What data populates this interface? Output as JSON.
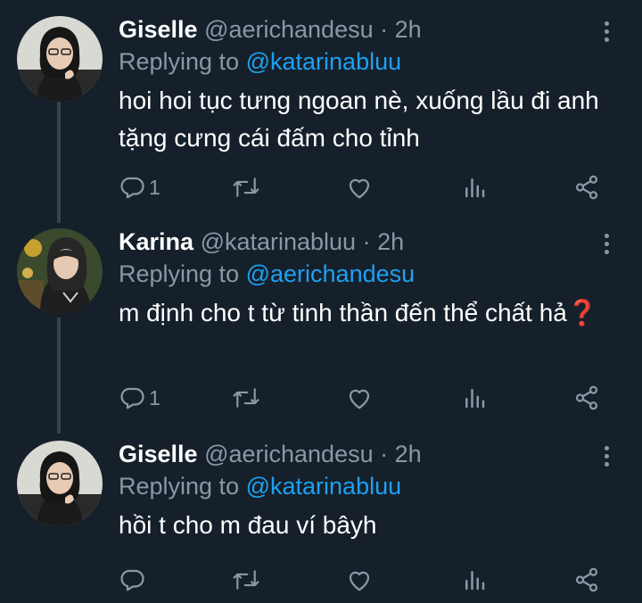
{
  "tweets": [
    {
      "name": "Giselle",
      "handle": "@aerichandesu",
      "separator": "·",
      "time": "2h",
      "replying_prefix": "Replying to",
      "replying_to": "@katarinabluu",
      "text": "hoi hoi tục tưng ngoan nè, xuống lầu đi anh tặng cưng cái đấm cho tỉnh",
      "emoji": "",
      "reply_count": "1"
    },
    {
      "name": "Karina",
      "handle": "@katarinabluu",
      "separator": "·",
      "time": "2h",
      "replying_prefix": "Replying to",
      "replying_to": "@aerichandesu",
      "text": "m định cho t từ tinh thần đến thể chất hả",
      "emoji": "❓",
      "reply_count": "1"
    },
    {
      "name": "Giselle",
      "handle": "@aerichandesu",
      "separator": "·",
      "time": "2h",
      "replying_prefix": "Replying to",
      "replying_to": "@katarinabluu",
      "text": "hồi t cho m đau ví bâyh",
      "emoji": "",
      "reply_count": ""
    }
  ],
  "icons": {
    "reply": "reply-icon",
    "retweet": "retweet-icon",
    "like": "heart-icon",
    "analytics": "analytics-icon",
    "share": "share-icon",
    "more": "more-vertical-icon"
  },
  "colors": {
    "background": "#15202b",
    "secondary_text": "#8899a6",
    "mention": "#1da1f2",
    "thread_line": "#38444d"
  }
}
